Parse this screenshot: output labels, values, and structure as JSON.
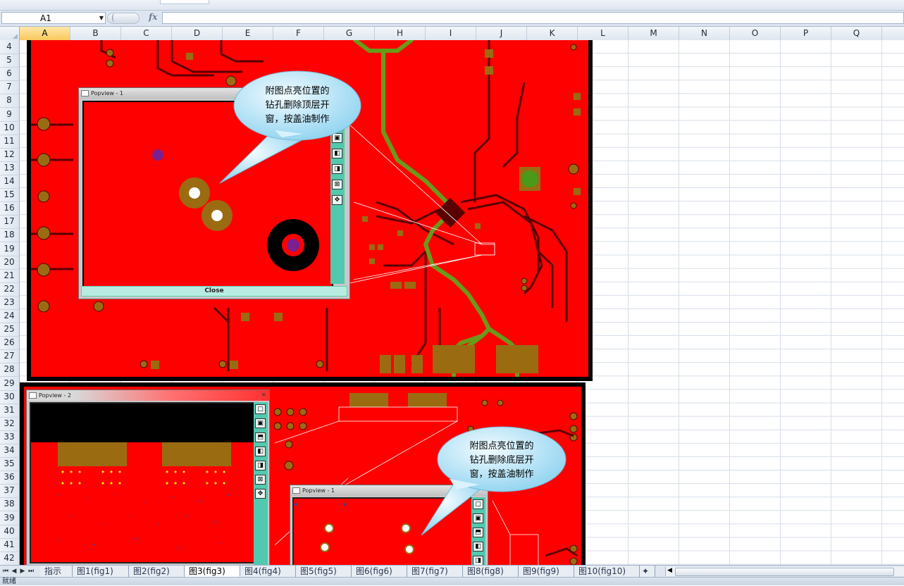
{
  "name_box": {
    "value": "A1"
  },
  "formula_bar": {
    "fx_label": "fx",
    "pill_label": "(",
    "value": ""
  },
  "columns": [
    "A",
    "B",
    "C",
    "D",
    "E",
    "F",
    "G",
    "H",
    "I",
    "J",
    "K",
    "L",
    "M",
    "N",
    "O",
    "P",
    "Q"
  ],
  "selected_column": "A",
  "rows": [
    "4",
    "5",
    "6",
    "7",
    "8",
    "9",
    "10",
    "11",
    "12",
    "13",
    "14",
    "15",
    "16",
    "17",
    "18",
    "19",
    "20",
    "21",
    "22",
    "23",
    "24",
    "25",
    "26",
    "27",
    "28",
    "29",
    "30",
    "31",
    "32",
    "33",
    "34",
    "35",
    "36",
    "37",
    "38",
    "39",
    "40",
    "41",
    "42"
  ],
  "popview_top": {
    "title": "Popview - 1",
    "close_label": "Close"
  },
  "popview_bottom_left": {
    "title": "Popview - 2",
    "close_x": "×"
  },
  "popview_bottom_right": {
    "title": "Popview - 1"
  },
  "callout_top": {
    "line1": "附图点亮位置的",
    "line2": "钻孔删除顶层开",
    "line3": "窗，按盖油制作"
  },
  "callout_bottom": {
    "line1": "附图点亮位置的",
    "line2": "钻孔删除底层开",
    "line3": "窗，按盖油制作"
  },
  "sheet_nav": [
    "⏮",
    "◀",
    "▶",
    "⏭"
  ],
  "sheet_tabs": [
    "指示",
    "图1(fig1)",
    "图2(fig2)",
    "图3(fig3)",
    "图4(fig4)",
    "图5(fig5)",
    "图6(fig6)",
    "图7(fig7)",
    "图8(fig8)",
    "图9(fig9)",
    "图10(fig10)"
  ],
  "active_sheet": "图3(fig3)",
  "status_text": "就绪",
  "colors": {
    "pcb_red": "#ff0000",
    "via_brown": "#9b6b12",
    "trace_green": "#6a9a1a",
    "popup_teal": "#52c9ae",
    "callout_fill": "#cdeefa"
  }
}
